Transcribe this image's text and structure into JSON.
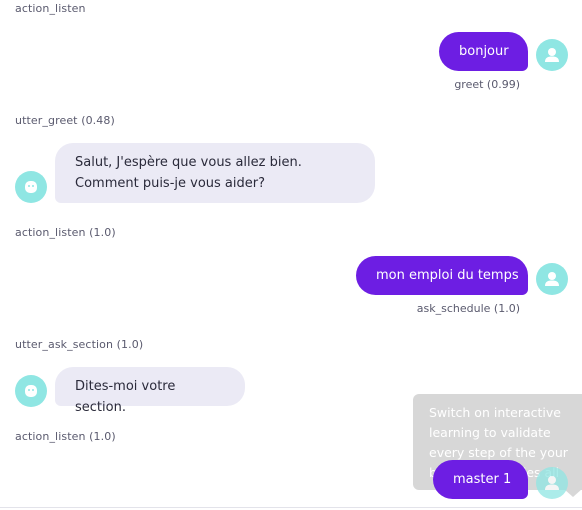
{
  "conversation": {
    "events": [
      {
        "action": "action_listen"
      },
      {
        "user": {
          "text": "bonjour",
          "intent": "greet (0.99)"
        }
      },
      {
        "action": "utter_greet (0.48)"
      },
      {
        "bot": {
          "text": "Salut, J'espère que vous allez bien. Comment puis-je vous aider?"
        }
      },
      {
        "action": "action_listen (1.0)"
      },
      {
        "user": {
          "text": "mon emploi du temps",
          "intent": "ask_schedule (1.0)"
        }
      },
      {
        "action": "utter_ask_section (1.0)"
      },
      {
        "bot": {
          "text": "Dites-moi votre section."
        }
      },
      {
        "action": "action_listen (1.0)"
      },
      {
        "user": {
          "text": "master 1"
        }
      }
    ]
  },
  "tooltip": {
    "text": "Switch on interactive learning to validate every step of the your bot as it classifies all messages"
  },
  "colors": {
    "user_bubble": "#6d1ee3",
    "bot_bubble": "#ebeaf5",
    "avatar": "#8fe6e3",
    "tooltip": "#d7d7d7"
  },
  "icons": {
    "user_avatar": "user-icon",
    "bot_avatar": "bot-face-icon"
  }
}
